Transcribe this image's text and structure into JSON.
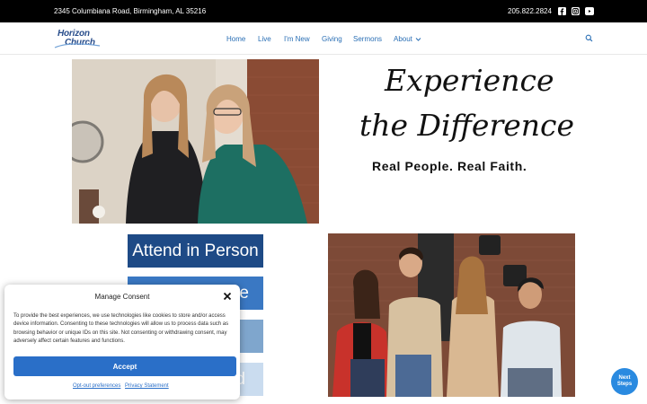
{
  "topbar": {
    "address": "2345 Columbiana Road, Birmingham, AL 35216",
    "phone": "205.822.2824",
    "social": [
      "facebook-icon",
      "instagram-icon",
      "youtube-icon"
    ]
  },
  "header": {
    "logo": {
      "line1": "Horizon",
      "line2": "Church"
    },
    "nav": [
      {
        "label": "Home"
      },
      {
        "label": "Live"
      },
      {
        "label": "I'm New"
      },
      {
        "label": "Giving"
      },
      {
        "label": "Sermons"
      },
      {
        "label": "About"
      }
    ]
  },
  "hero": {
    "script_line1": "Experience",
    "script_line2": "the Difference",
    "tagline": "Real People. Real Faith."
  },
  "ctas": [
    {
      "label": "Attend in Person",
      "color": "#1e4a86"
    },
    {
      "label": "e",
      "color": "#3a78c3"
    },
    {
      "label": "",
      "color": "#7fa6cd"
    },
    {
      "label": "d",
      "color": "#cadcef"
    }
  ],
  "consent": {
    "title": "Manage Consent",
    "body": "To provide the best experiences, we use technologies like cookies to store and/or access device information. Consenting to these technologies will allow us to process data such as browsing behavior or unique IDs on this site. Not consenting or withdrawing consent, may adversely affect certain features and functions.",
    "accept_label": "Accept",
    "optout_label": "Opt-out preferences",
    "privacy_label": "Privacy Statement"
  },
  "next_steps": {
    "line1": "Next",
    "line2": "Steps"
  },
  "colors": {
    "brand": "#2b4f8c",
    "link": "#2a6fb5",
    "accent": "#2a6fc8"
  }
}
